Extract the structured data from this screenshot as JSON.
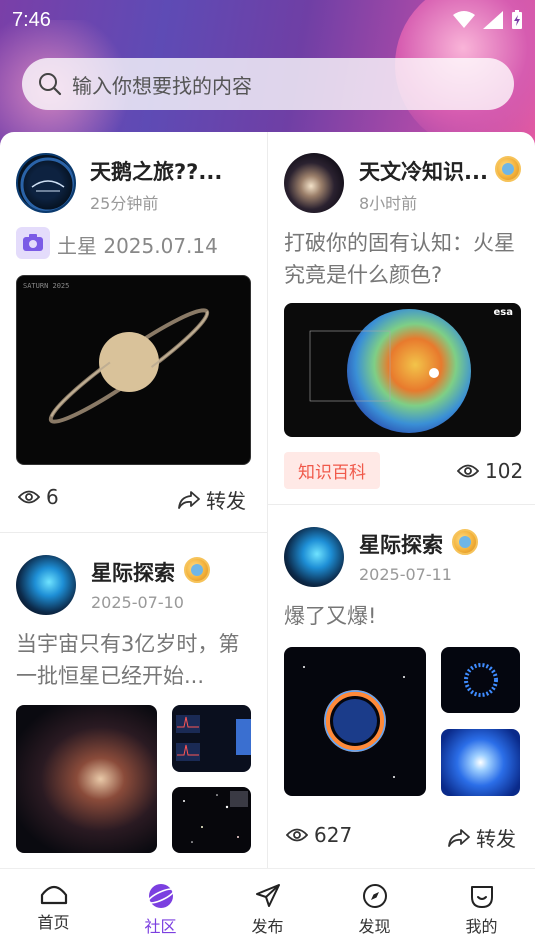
{
  "status": {
    "time": "7:46"
  },
  "search": {
    "placeholder": "输入你想要找的内容"
  },
  "posts": {
    "p1": {
      "author": "天鹅之旅??...",
      "time": "25分钟前",
      "camera_text": "土星 2025.07.14",
      "image_label": "SATURN 2025",
      "views": "6",
      "share": "转发"
    },
    "p2": {
      "author": "天文冷知识...",
      "time": "8小时前",
      "text": "打破你的固有认知：火星究竟是什么颜色?",
      "image_label": "esa",
      "tag": "知识百科",
      "views": "102"
    },
    "p3": {
      "author": "星际探索",
      "time": "2025-07-10",
      "text": "当宇宙只有3亿岁时，第一批恒星已经开始..."
    },
    "p4": {
      "author": "星际探索",
      "time": "2025-07-11",
      "text": "爆了又爆!",
      "views": "627",
      "share": "转发"
    }
  },
  "tabs": [
    {
      "label": "首页",
      "icon": "home-icon"
    },
    {
      "label": "社区",
      "icon": "planet-icon"
    },
    {
      "label": "发布",
      "icon": "send-icon"
    },
    {
      "label": "发现",
      "icon": "compass-icon"
    },
    {
      "label": "我的",
      "icon": "profile-icon"
    }
  ],
  "colors": {
    "accent": "#7b3fe0",
    "tag_bg": "#ffe9e6",
    "tag_text": "#f0594a"
  }
}
